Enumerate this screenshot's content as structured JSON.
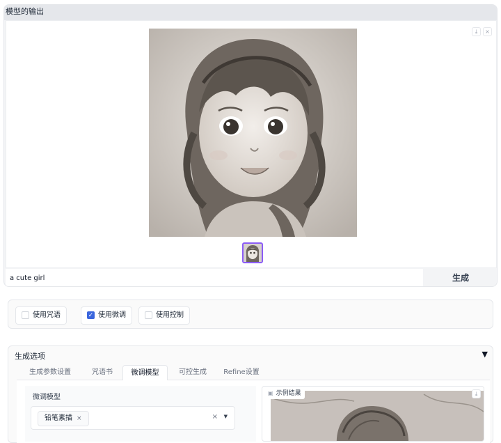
{
  "output": {
    "label": "模型的输出",
    "download_icon": "⤓",
    "close_icon": "×"
  },
  "prompt": {
    "value": "a cute girl",
    "generate_label": "生成"
  },
  "checkboxes": [
    {
      "label": "使用咒语",
      "checked": false
    },
    {
      "label": "使用微调",
      "checked": true
    },
    {
      "label": "使用控制",
      "checked": false
    }
  ],
  "options": {
    "title": "生成选项",
    "tabs": [
      "生成参数设置",
      "咒语书",
      "微调模型",
      "可控生成",
      "Refine设置"
    ],
    "active_tab": "微调模型",
    "finetune": {
      "label": "微调模型",
      "selected_token": "铅笔素描",
      "token_remove": "×",
      "clear": "×",
      "caret": "▼"
    },
    "example": {
      "label": "示例结果",
      "download_icon": "⤓"
    },
    "collapse_arrow": "▼"
  },
  "colors": {
    "accent": "#3b66dd",
    "thumb_border": "#8b5cf6"
  }
}
